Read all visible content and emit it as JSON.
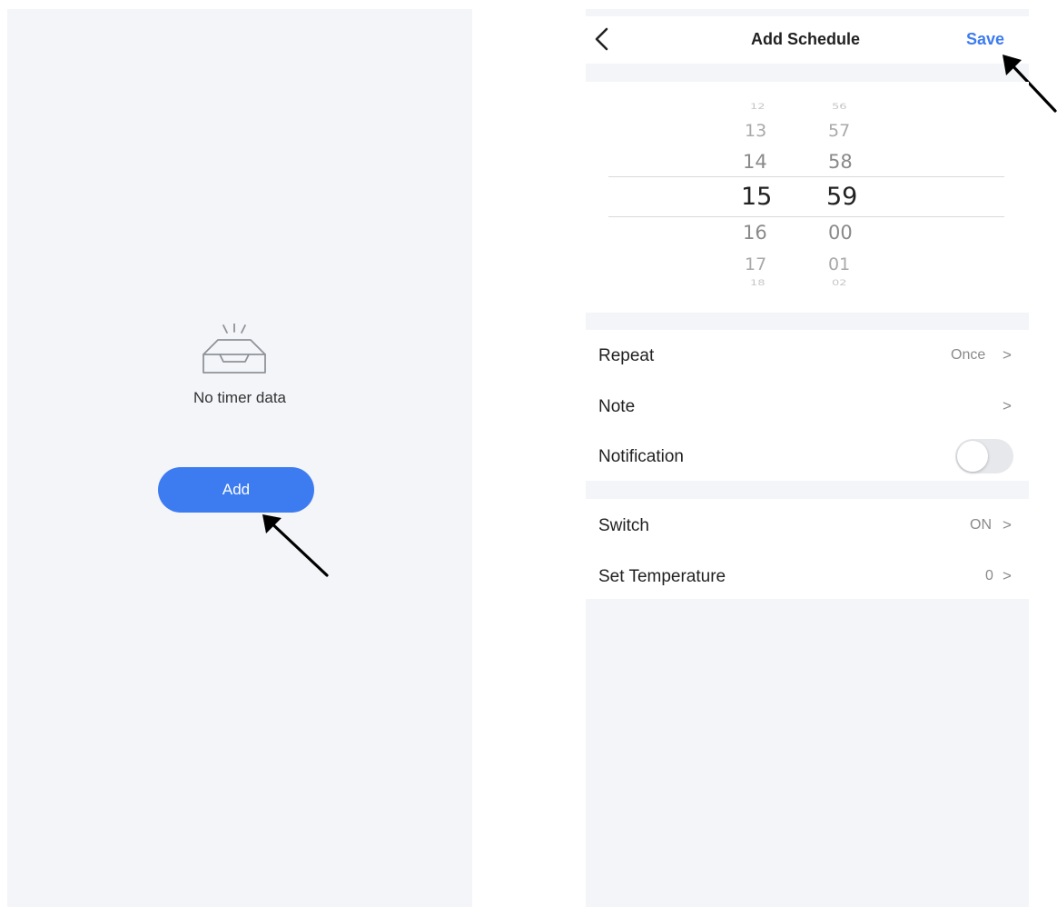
{
  "left_screen": {
    "empty_text": "No timer data",
    "add_label": "Add",
    "icon": "empty-box-icon"
  },
  "right_screen": {
    "title": "Add Schedule",
    "save_label": "Save",
    "back_icon": "chevron-left-icon",
    "picker": {
      "hours": [
        "12",
        "13",
        "14",
        "15",
        "16",
        "17",
        "18"
      ],
      "minutes": [
        "56",
        "57",
        "58",
        "59",
        "00",
        "01",
        "02"
      ],
      "selected_hour": "15",
      "selected_minute": "59"
    },
    "settings": [
      {
        "label": "Repeat",
        "value": "Once",
        "chevron": ">"
      },
      {
        "label": "Note",
        "value": "",
        "chevron": ">"
      },
      {
        "label": "Notification",
        "toggle": false
      }
    ],
    "actions": [
      {
        "label": "Switch",
        "value": "ON",
        "chevron": ">"
      },
      {
        "label": "Set Temperature",
        "value": "0",
        "chevron": ">"
      }
    ]
  },
  "colors": {
    "accent": "#3d7cf0",
    "background": "#f3f5f9"
  }
}
